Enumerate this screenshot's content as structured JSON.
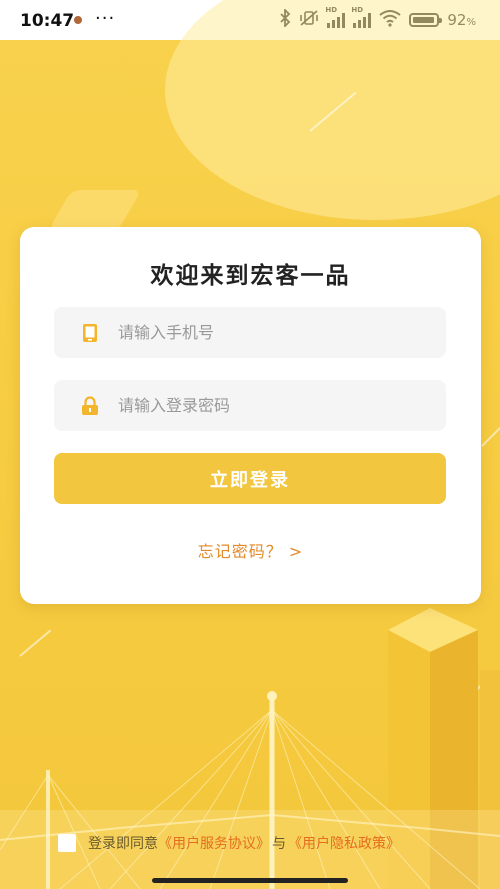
{
  "status_bar": {
    "time": "10:47",
    "more": "···",
    "battery_percent": "92",
    "battery_level": 0.92
  },
  "card": {
    "title": "欢迎来到宏客一品",
    "phone_placeholder": "请输入手机号",
    "password_placeholder": "请输入登录密码",
    "login_label": "立即登录",
    "forgot_label": "忘记密码？ >"
  },
  "agreement": {
    "prefix": "登录即同意",
    "service_link": "《用户服务协议》",
    "conjunction": "与",
    "privacy_link": "《用户隐私政策》"
  },
  "colors": {
    "accent": "#f2c63e",
    "link": "#e46d1f",
    "forgot": "#e38a2a",
    "background": "#f7cd43"
  }
}
